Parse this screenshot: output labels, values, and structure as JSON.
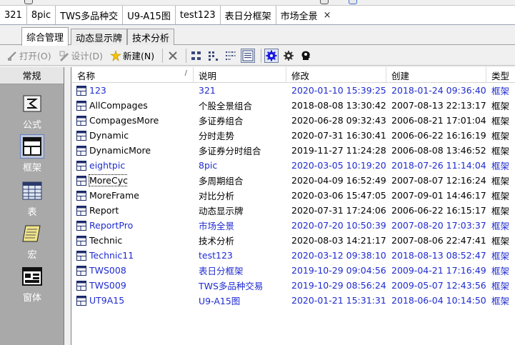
{
  "doc_tabs": [
    {
      "label": "321"
    },
    {
      "label": "8pic"
    },
    {
      "label": "TWS多品种交"
    },
    {
      "label": "U9-A15图"
    },
    {
      "label": "test123"
    },
    {
      "label": "表日分框架"
    },
    {
      "label": "市场全景"
    }
  ],
  "doc_tab_close": "×",
  "module_tabs": [
    {
      "label": "综合管理",
      "active": true
    },
    {
      "label": "动态显示牌",
      "active": false
    },
    {
      "label": "技术分析",
      "active": false
    }
  ],
  "toolbar": {
    "open_label": "打开(O)",
    "design_label": "设计(D)",
    "new_label": "新建(N)"
  },
  "sidebar": {
    "header": "常规",
    "items": [
      {
        "label": "公式"
      },
      {
        "label": "框架"
      },
      {
        "label": "表"
      },
      {
        "label": "宏"
      },
      {
        "label": "窗体"
      }
    ]
  },
  "list": {
    "columns": [
      "名称",
      "说明",
      "修改",
      "创建",
      "类型"
    ],
    "rows": [
      {
        "name": "123",
        "desc": "321",
        "modified": "2020-01-10 15:39:25",
        "created": "2018-01-24 09:36:40",
        "type": "框架",
        "blue": true
      },
      {
        "name": "AllCompages",
        "desc": "个股全景组合",
        "modified": "2018-08-08 13:30:42",
        "created": "2007-08-13 22:13:17",
        "type": "框架",
        "blue": false
      },
      {
        "name": "CompagesMore",
        "desc": "多证券组合",
        "modified": "2020-06-28 09:32:43",
        "created": "2006-08-21 17:01:04",
        "type": "框架",
        "blue": false
      },
      {
        "name": "Dynamic",
        "desc": "分时走势",
        "modified": "2020-07-31 16:30:41",
        "created": "2006-06-22 16:16:19",
        "type": "框架",
        "blue": false
      },
      {
        "name": "DynamicMore",
        "desc": "多证券分时组合",
        "modified": "2019-11-27 11:24:28",
        "created": "2006-08-08 13:46:52",
        "type": "框架",
        "blue": false
      },
      {
        "name": "eightpic",
        "desc": "8pic",
        "modified": "2020-03-05 10:19:20",
        "created": "2018-07-26 11:14:04",
        "type": "框架",
        "blue": true
      },
      {
        "name": "MoreCyc",
        "desc": "多周期组合",
        "modified": "2020-04-09 16:52:49",
        "created": "2007-08-07 12:16:24",
        "type": "框架",
        "blue": false,
        "focused": true
      },
      {
        "name": "MoreFrame",
        "desc": "对比分析",
        "modified": "2020-03-06 15:47:05",
        "created": "2007-09-01 14:46:17",
        "type": "框架",
        "blue": false
      },
      {
        "name": "Report",
        "desc": "动态显示牌",
        "modified": "2020-07-31 17:24:06",
        "created": "2006-06-22 16:15:17",
        "type": "框架",
        "blue": false
      },
      {
        "name": "ReportPro",
        "desc": "市场全景",
        "modified": "2020-07-20 10:50:39",
        "created": "2007-08-20 17:03:37",
        "type": "框架",
        "blue": true
      },
      {
        "name": "Technic",
        "desc": "技术分析",
        "modified": "2020-08-03 14:21:17",
        "created": "2007-08-06 22:47:41",
        "type": "框架",
        "blue": false
      },
      {
        "name": "Technic11",
        "desc": "test123",
        "modified": "2020-03-12 09:38:10",
        "created": "2018-08-13 08:52:47",
        "type": "框架",
        "blue": true
      },
      {
        "name": "TWS008",
        "desc": "表日分框架",
        "modified": "2019-10-29 09:04:56",
        "created": "2009-04-21 17:16:49",
        "type": "框架",
        "blue": true
      },
      {
        "name": "TWS009",
        "desc": "TWS多品种交易",
        "modified": "2019-10-29 08:56:24",
        "created": "2009-05-07 12:43:56",
        "type": "框架",
        "blue": true
      },
      {
        "name": "UT9A15",
        "desc": "U9-A15图",
        "modified": "2020-01-21 15:31:31",
        "created": "2018-06-04 10:14:50",
        "type": "框架",
        "blue": true
      }
    ]
  },
  "colors": {
    "link_blue": "#1f2bd0",
    "sidebar_bg": "#a9a9a9",
    "selected_icon_bg": "#bcc6d8"
  }
}
